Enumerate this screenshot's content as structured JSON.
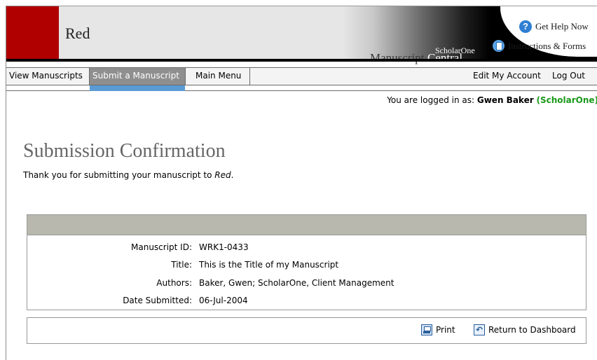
{
  "header": {
    "journal_name": "Red",
    "brand_top": "ScholarOne",
    "brand_manuscript": "Manuscript",
    "brand_central": "Central",
    "help_link": "Get Help Now",
    "instructions_link": "Instructions & Forms",
    "icons": {
      "help": "question-icon",
      "instructions": "document-icon"
    }
  },
  "nav": {
    "items": [
      {
        "label": "View Manuscripts",
        "active": false
      },
      {
        "label": "Submit a Manuscript",
        "active": true
      },
      {
        "label": "Main Menu",
        "active": false
      }
    ],
    "right_items": [
      {
        "label": "Edit My Account"
      },
      {
        "label": "Log Out"
      }
    ]
  },
  "session": {
    "prefix": "You are logged in as:",
    "user": "Gwen Baker",
    "org": "(ScholarOne)"
  },
  "page": {
    "title": "Submission Confirmation",
    "thanks_prefix": "Thank you for submitting your manuscript to ",
    "thanks_journal": "Red",
    "thanks_suffix": "."
  },
  "details": [
    {
      "label": "Manuscript ID:",
      "value": "WRK1-0433"
    },
    {
      "label": "Title:",
      "value": "This is the Title of my Manuscript"
    },
    {
      "label": "Authors:",
      "value": "Baker, Gwen; ScholarOne, Client Management"
    },
    {
      "label": "Date Submitted:",
      "value": "06-Jul-2004"
    }
  ],
  "actions": {
    "print_label": "Print",
    "return_label": "Return to Dashboard",
    "icons": {
      "print": "printer-icon",
      "return": "return-arrow-icon"
    }
  },
  "colors": {
    "brand_red": "#b00000",
    "active_tab_bg": "#8f8f8f",
    "active_tab_underline": "#5b9bd5",
    "org_green": "#1a9a1a",
    "details_header": "#b8b8ae"
  }
}
